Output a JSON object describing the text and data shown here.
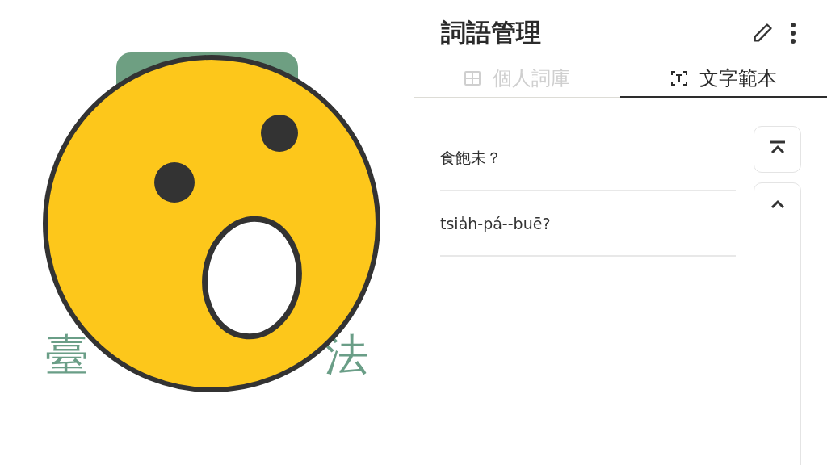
{
  "logo": {
    "text_fragments": [
      "臺",
      "法"
    ]
  },
  "header": {
    "title": "詞語管理"
  },
  "tabs": [
    {
      "label": "個人詞庫",
      "kind": "book",
      "selected": false
    },
    {
      "label": "文字範本",
      "kind": "text-scan",
      "selected": true
    }
  ],
  "templates": [
    "食飽未？",
    "tsia̍h-pá--buē?"
  ]
}
